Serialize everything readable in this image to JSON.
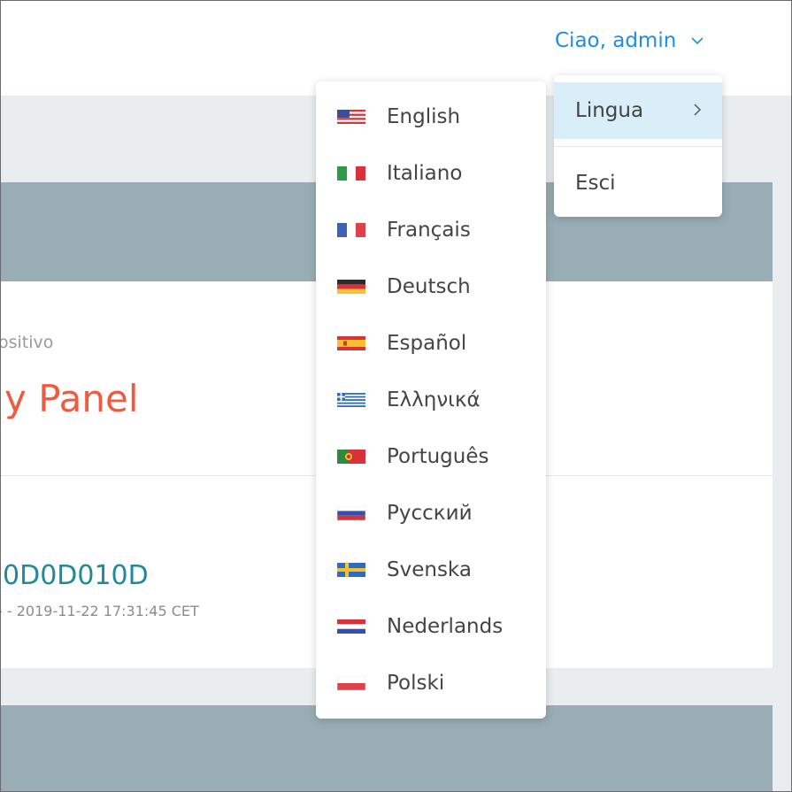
{
  "header": {
    "greeting": "Ciao, admin",
    "accent_color": "#1d8fe0",
    "icon": "chevron-down-icon"
  },
  "user_dropdown": {
    "items": [
      {
        "label": "Lingua",
        "icon": "chevron-right-icon",
        "active": true
      },
      {
        "label": "Esci"
      }
    ]
  },
  "language_menu": {
    "items": [
      {
        "label": "English",
        "flag": "us-flag-icon"
      },
      {
        "label": "Italiano",
        "flag": "italy-flag-icon"
      },
      {
        "label": "Français",
        "flag": "france-flag-icon"
      },
      {
        "label": "Deutsch",
        "flag": "germany-flag-icon"
      },
      {
        "label": "Español",
        "flag": "spain-flag-icon"
      },
      {
        "label": "Ελληνικά",
        "flag": "greece-flag-icon"
      },
      {
        "label": "Português",
        "flag": "portugal-flag-icon"
      },
      {
        "label": "Русский",
        "flag": "russia-flag-icon"
      },
      {
        "label": "Svenska",
        "flag": "sweden-flag-icon"
      },
      {
        "label": "Nederlands",
        "flag": "netherlands-flag-icon"
      },
      {
        "label": "Polski",
        "flag": "poland-flag-icon"
      }
    ]
  },
  "device": {
    "label_fragment": "ositivo",
    "name_fragment": "y Panel",
    "id_fragment": "0D0D010D",
    "date_fragment": "- - 2019-11-22 17:31:45 CET",
    "name_color": "#ef5b3e",
    "id_color": "#1f8a9c"
  }
}
